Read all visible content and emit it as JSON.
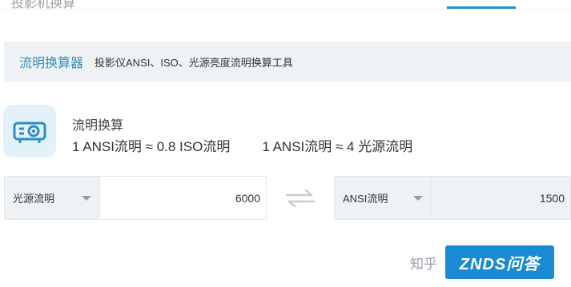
{
  "topbar": {
    "title": "投影机换算"
  },
  "header": {
    "title": "流明换算器",
    "subtitle": "投影仪ANSI、ISO、光源亮度流明换算工具"
  },
  "info": {
    "icon": "projector-icon",
    "title": "流明换算",
    "ratio_iso": "1 ANSI流明 ≈ 0.8 ISO流明",
    "ratio_light": "1 ANSI流明 ≈ 4 光源流明"
  },
  "converter": {
    "from_unit": "光源流明",
    "from_value": "6000",
    "swap_icon": "swap-arrows-icon",
    "to_unit": "ANSI流明",
    "to_value": "1500"
  },
  "watermark": {
    "zhihu": "知乎",
    "logo_text": "ZNDS问答"
  },
  "colors": {
    "accent": "#2f8fc0",
    "panel": "#eef2f5",
    "icon_bg": "#e3f1fa",
    "logo_bg": "#1a8ad4"
  }
}
